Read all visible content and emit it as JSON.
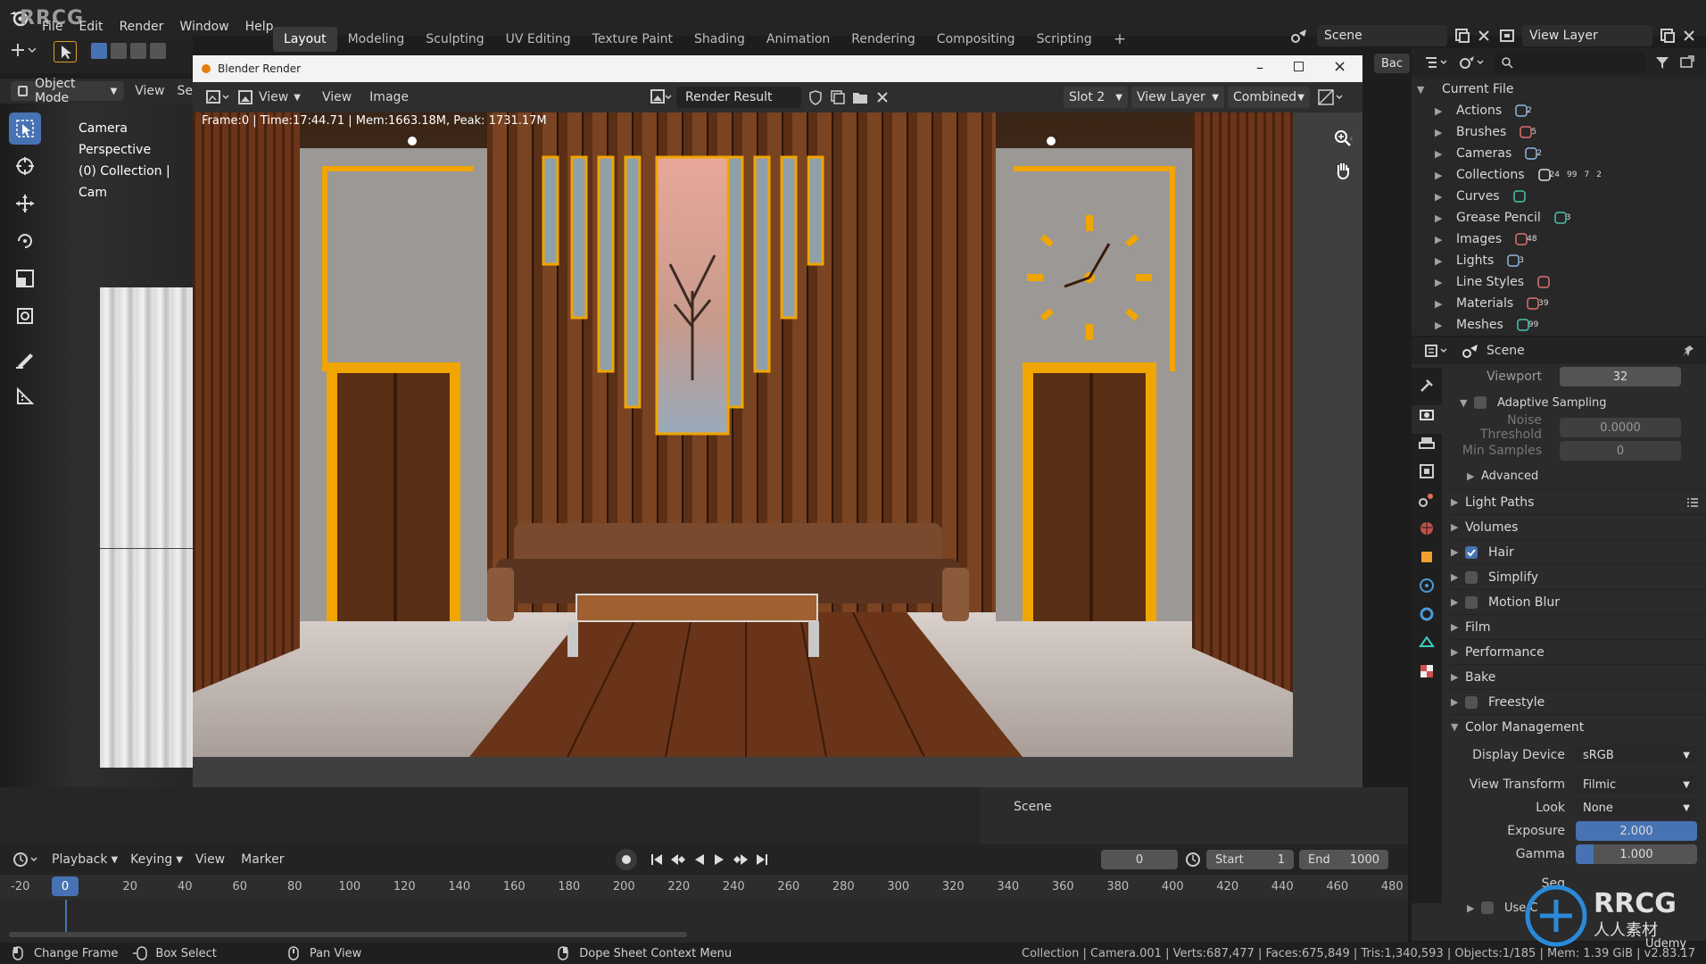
{
  "app": {
    "logo_text": "RRCG"
  },
  "menu": [
    "File",
    "Edit",
    "Render",
    "Window",
    "Help"
  ],
  "workspaces": {
    "tabs": [
      "Layout",
      "Modeling",
      "Sculpting",
      "UV Editing",
      "Texture Paint",
      "Shading",
      "Animation",
      "Rendering",
      "Compositing",
      "Scripting"
    ],
    "active": "Layout"
  },
  "scene_field": "Scene",
  "view_layer_field": "View Layer",
  "viewport": {
    "mode": "Object Mode",
    "view_menu": "View",
    "select_menu_partial": "Se",
    "overlay_line1": "Camera Perspective",
    "overlay_line2": "(0) Collection | Cam"
  },
  "render_window": {
    "title": "Blender Render",
    "menus": [
      "View",
      "View",
      "Image"
    ],
    "image_name": "Render Result",
    "slot": "Slot 2",
    "view_layer": "View Layer",
    "pass": "Combined",
    "stats": "Frame:0 | Time:17:44.71 | Mem:1663.18M, Peak: 1731.17M",
    "back_button": "Bac"
  },
  "outliner": {
    "title": "Current File",
    "items": [
      {
        "label": "Actions",
        "count": "2"
      },
      {
        "label": "Brushes",
        "count": "5"
      },
      {
        "label": "Cameras",
        "count": "2"
      },
      {
        "label": "Collections",
        "count": "24"
      },
      {
        "label": "Curves",
        "count": ""
      },
      {
        "label": "Grease Pencil",
        "count": "3"
      },
      {
        "label": "Images",
        "count": "48"
      },
      {
        "label": "Lights",
        "count": "3"
      },
      {
        "label": "Line Styles",
        "count": ""
      },
      {
        "label": "Materials",
        "count": "39"
      },
      {
        "label": "Meshes",
        "count": "99"
      }
    ],
    "collections_extra_counts": [
      "99",
      "7",
      "2"
    ]
  },
  "properties": {
    "context": "Scene",
    "viewport_label": "Viewport",
    "viewport_value": "32",
    "adaptive_sampling": "Adaptive Sampling",
    "noise_threshold_label": "Noise Threshold",
    "noise_threshold_value": "0.0000",
    "min_samples_label": "Min Samples",
    "min_samples_value": "0",
    "advanced": "Advanced",
    "panels": [
      {
        "label": "Light Paths",
        "checkbox": null
      },
      {
        "label": "Volumes",
        "checkbox": null
      },
      {
        "label": "Hair",
        "checkbox": true
      },
      {
        "label": "Simplify",
        "checkbox": false
      },
      {
        "label": "Motion Blur",
        "checkbox": false
      },
      {
        "label": "Film",
        "checkbox": null
      },
      {
        "label": "Performance",
        "checkbox": null
      },
      {
        "label": "Bake",
        "checkbox": null
      },
      {
        "label": "Freestyle",
        "checkbox": false
      },
      {
        "label": "Color Management",
        "checkbox": null
      }
    ],
    "display_device_label": "Display Device",
    "display_device_value": "sRGB",
    "view_transform_label": "View Transform",
    "view_transform_value": "Filmic",
    "look_label": "Look",
    "look_value": "None",
    "exposure_label": "Exposure",
    "exposure_value": "2.000",
    "gamma_label": "Gamma",
    "gamma_value": "1.000",
    "sequencer_partial": "Seq",
    "use_curves_partial": "Use C"
  },
  "dope_sheet_label": "Scene",
  "timeline": {
    "menus": [
      "Playback",
      "Keying",
      "View",
      "Marker"
    ],
    "current_frame": "0",
    "start_label": "Start",
    "start_value": "1",
    "end_label": "End",
    "end_value": "1000",
    "ticks": [
      "-20",
      "0",
      "20",
      "40",
      "60",
      "80",
      "100",
      "120",
      "140",
      "160",
      "180",
      "200",
      "220",
      "240",
      "260",
      "280",
      "300",
      "320",
      "340",
      "360",
      "380",
      "400",
      "420",
      "440",
      "460",
      "480"
    ]
  },
  "statusbar": {
    "change_frame": "Change Frame",
    "box_select": "Box Select",
    "pan_view": "Pan View",
    "context_menu": "Dope Sheet Context Menu",
    "stats": "Collection | Camera.001 | Verts:687,477 | Faces:675,849 | Tris:1,340,593 | Objects:1/185 | Mem: 1.39 GiB | v2.83.17"
  },
  "watermark": {
    "brand": "RRCG",
    "cn": "人人素材",
    "udemy": "Udemy"
  },
  "colors": {
    "accent": "#4772b3",
    "gold": "#f0a500",
    "wood": "#5a2f16"
  }
}
